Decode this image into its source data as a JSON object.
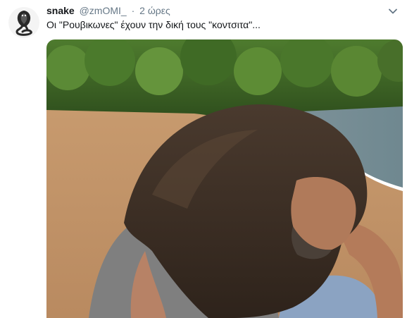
{
  "tweet": {
    "author_name": "snake",
    "author_handle": "@zmOMI_",
    "separator": "·",
    "time": "2 ώρες",
    "text": "Οι \"Ρουβικωνες\" έχουν την δική τους \"κοντσιτα\"..."
  },
  "icons": {
    "avatar": "cobra-snake-avatar",
    "caret": "chevron-down-icon"
  },
  "colors": {
    "primary_text": "#14171a",
    "secondary_text": "#657786"
  }
}
